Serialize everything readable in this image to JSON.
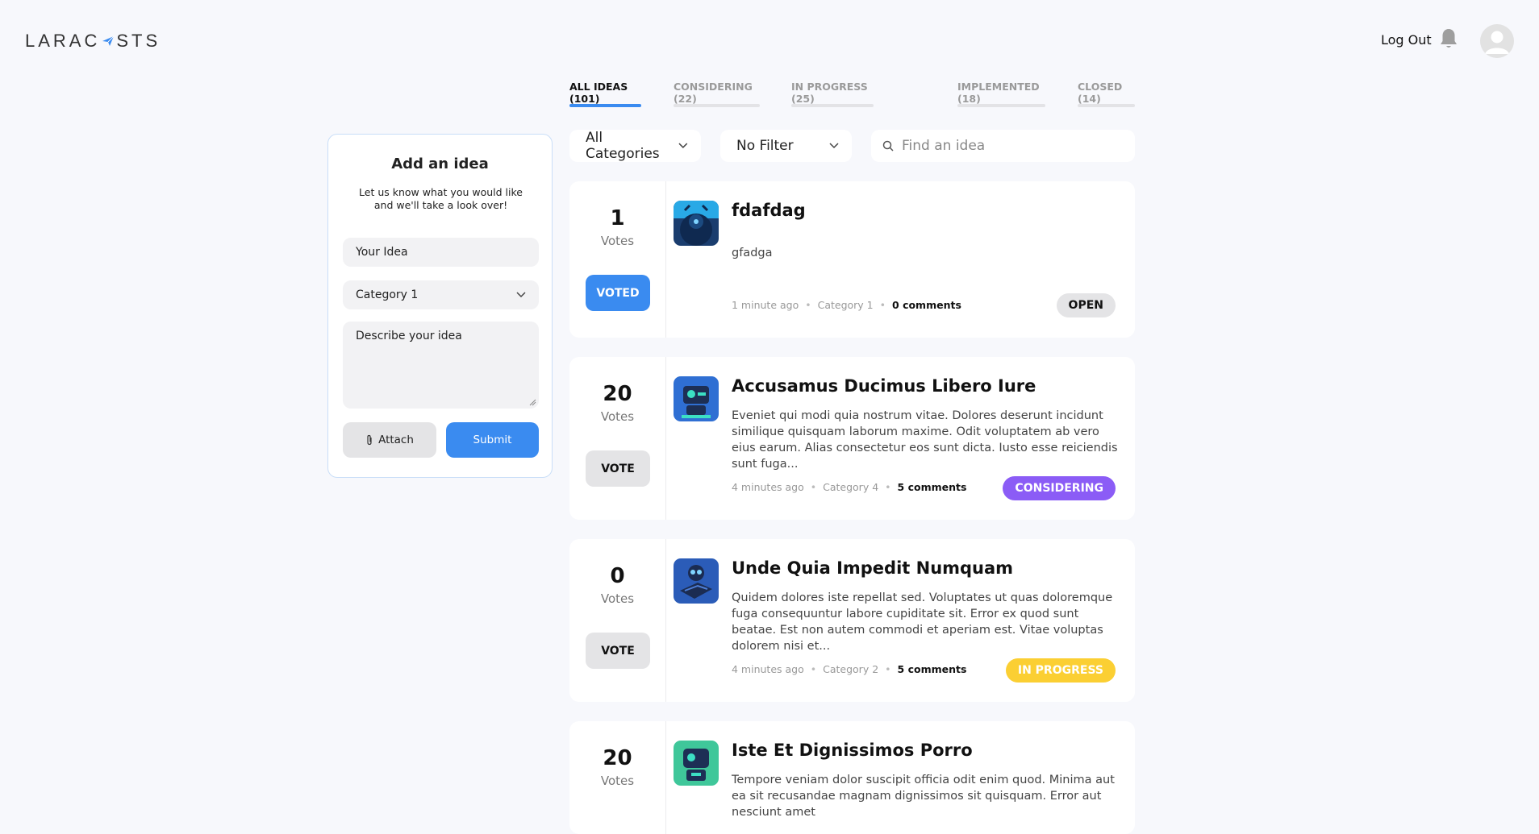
{
  "header": {
    "logo_text_1": "LARAC",
    "logo_text_2": "STS",
    "logout_label": "Log Out"
  },
  "tabs": [
    {
      "label": "ALL IDEAS (101)",
      "active": true
    },
    {
      "label": "CONSIDERING (22)",
      "active": false
    },
    {
      "label": "IN PROGRESS (25)",
      "active": false
    },
    {
      "label": "IMPLEMENTED (18)",
      "active": false
    },
    {
      "label": "CLOSED (14)",
      "active": false
    }
  ],
  "filters": {
    "category": "All Categories",
    "other": "No Filter",
    "search_placeholder": "Find an idea"
  },
  "add_idea": {
    "title": "Add an idea",
    "subtitle": "Let us know what you would like and we'll take a look over!",
    "idea_placeholder": "Your Idea",
    "category_value": "Category 1",
    "description_placeholder": "Describe your idea",
    "attach_label": "Attach",
    "submit_label": "Submit"
  },
  "ideas": [
    {
      "votes": "1",
      "votes_label": "Votes",
      "vote_button": "VOTED",
      "title": "fdafdag",
      "body": "gfadga",
      "time": "1 minute ago",
      "category": "Category 1",
      "comments": "0 comments",
      "status": "OPEN"
    },
    {
      "votes": "20",
      "votes_label": "Votes",
      "vote_button": "VOTE",
      "title": "Accusamus Ducimus Libero Iure",
      "body": "Eveniet qui modi quia nostrum vitae. Dolores deserunt incidunt similique quisquam laborum maxime. Odit voluptatem ab vero eius earum. Alias consectetur eos sunt dicta. Iusto esse reiciendis sunt fuga...",
      "time": "4 minutes ago",
      "category": "Category 4",
      "comments": "5 comments",
      "status": "CONSIDERING"
    },
    {
      "votes": "0",
      "votes_label": "Votes",
      "vote_button": "VOTE",
      "title": "Unde Quia Impedit Numquam",
      "body": "Quidem dolores iste repellat sed. Voluptates ut quas doloremque fuga consequuntur labore cupiditate sit. Error ex quod sunt beatae. Est non autem commodi et aperiam est. Vitae voluptas dolorem nisi et...",
      "time": "4 minutes ago",
      "category": "Category 2",
      "comments": "5 comments",
      "status": "IN PROGRESS"
    },
    {
      "votes": "20",
      "votes_label": "Votes",
      "title": "Iste Et Dignissimos Porro",
      "body": "Tempore veniam dolor suscipit officia odit enim quod. Minima aut ea sit recusandae magnam dignissimos sit quisquam. Error aut nesciunt amet"
    }
  ],
  "colors": {
    "accent": "#3a8bf0",
    "status_open_bg": "#e4e4e6",
    "status_considering_bg": "#8b5cf6",
    "status_in_progress_bg": "#fbcf33"
  },
  "icons": [
    "plane-icon",
    "bell-icon",
    "avatar-icon",
    "chevron-down-icon",
    "search-icon",
    "paperclip-icon",
    "resize-handle-icon"
  ]
}
